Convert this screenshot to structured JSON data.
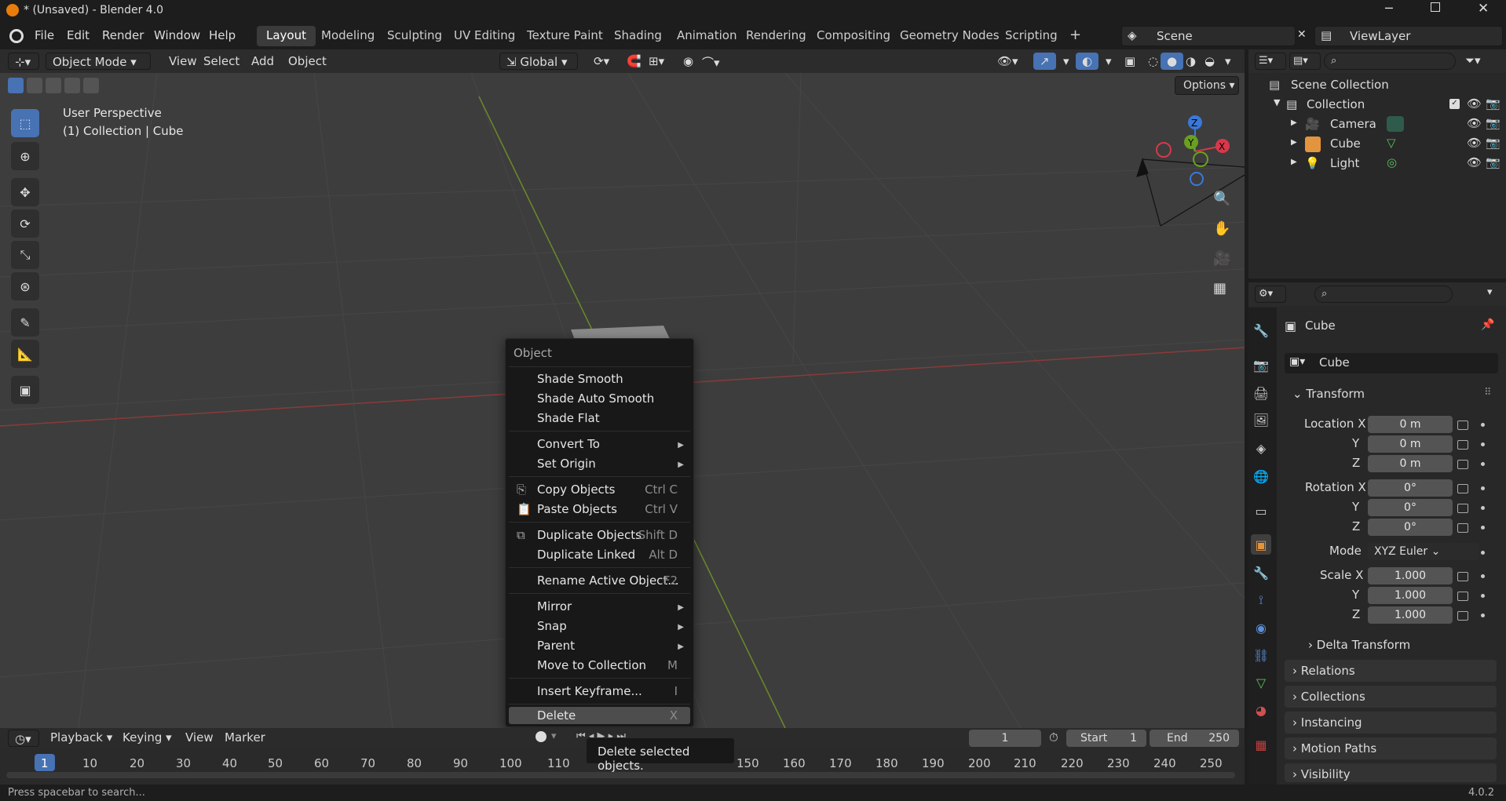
{
  "window": {
    "title": "* (Unsaved) - Blender 4.0"
  },
  "menu": [
    "File",
    "Edit",
    "Render",
    "Window",
    "Help"
  ],
  "workspaces": [
    "Layout",
    "Modeling",
    "Sculpting",
    "UV Editing",
    "Texture Paint",
    "Shading",
    "Animation",
    "Rendering",
    "Compositing",
    "Geometry Nodes",
    "Scripting"
  ],
  "workspace_add": "+",
  "scene": "Scene",
  "view_layer": "ViewLayer",
  "viewport": {
    "mode": "Object Mode",
    "menus": [
      "View",
      "Select",
      "Add",
      "Object"
    ],
    "orientation": "Global",
    "options": "Options",
    "overlay_line1": "User Perspective",
    "overlay_line2": "(1) Collection | Cube",
    "gizmo": {
      "z": "Z",
      "y": "Y",
      "x": "X"
    }
  },
  "context_menu": {
    "title": "Object",
    "items": [
      {
        "label": "Shade Smooth",
        "shortcut": ""
      },
      {
        "label": "Shade Auto Smooth",
        "shortcut": ""
      },
      {
        "label": "Shade Flat",
        "shortcut": ""
      },
      {
        "label": "Convert To",
        "shortcut": ""
      },
      {
        "label": "Set Origin",
        "shortcut": ""
      },
      {
        "label": "Copy Objects",
        "shortcut": "Ctrl C"
      },
      {
        "label": "Paste Objects",
        "shortcut": "Ctrl V"
      },
      {
        "label": "Duplicate Objects",
        "shortcut": "Shift D"
      },
      {
        "label": "Duplicate Linked",
        "shortcut": "Alt D"
      },
      {
        "label": "Rename Active Object...",
        "shortcut": "F2"
      },
      {
        "label": "Mirror",
        "shortcut": ""
      },
      {
        "label": "Snap",
        "shortcut": ""
      },
      {
        "label": "Parent",
        "shortcut": ""
      },
      {
        "label": "Move to Collection",
        "shortcut": "M"
      },
      {
        "label": "Insert Keyframe...",
        "shortcut": "I"
      },
      {
        "label": "Delete",
        "shortcut": "X"
      }
    ]
  },
  "tooltip": "Delete selected objects.",
  "timeline": {
    "menus": [
      "Playback",
      "Keying",
      "View",
      "Marker"
    ],
    "current_frame": "1",
    "start_label": "Start",
    "start": "1",
    "end_label": "End",
    "end": "250",
    "ticks": [
      "1",
      "10",
      "20",
      "30",
      "40",
      "50",
      "60",
      "70",
      "80",
      "90",
      "100",
      "110",
      "150",
      "160",
      "170",
      "180",
      "190",
      "200",
      "210",
      "220",
      "230",
      "240",
      "250"
    ]
  },
  "status": {
    "hint": "Press spacebar to search...",
    "version": "4.0.2"
  },
  "outliner": {
    "root": "Scene Collection",
    "collection": "Collection",
    "objects": [
      "Camera",
      "Cube",
      "Light"
    ]
  },
  "properties": {
    "object_name": "Cube",
    "data_name": "Cube",
    "transform": "Transform",
    "location_label": "Location X",
    "rotation_label": "Rotation X",
    "scale_label": "Scale X",
    "y": "Y",
    "z": "Z",
    "loc": [
      "0 m",
      "0 m",
      "0 m"
    ],
    "rot": [
      "0°",
      "0°",
      "0°"
    ],
    "mode_label": "Mode",
    "mode": "XYZ Euler",
    "scale": [
      "1.000",
      "1.000",
      "1.000"
    ],
    "sections": [
      "Delta Transform",
      "Relations",
      "Collections",
      "Instancing",
      "Motion Paths",
      "Visibility"
    ]
  },
  "colors": {
    "accent": "#4772b3",
    "header": "#2b2b2b",
    "viewport": "#3d3d3d",
    "menu": "#181818"
  }
}
